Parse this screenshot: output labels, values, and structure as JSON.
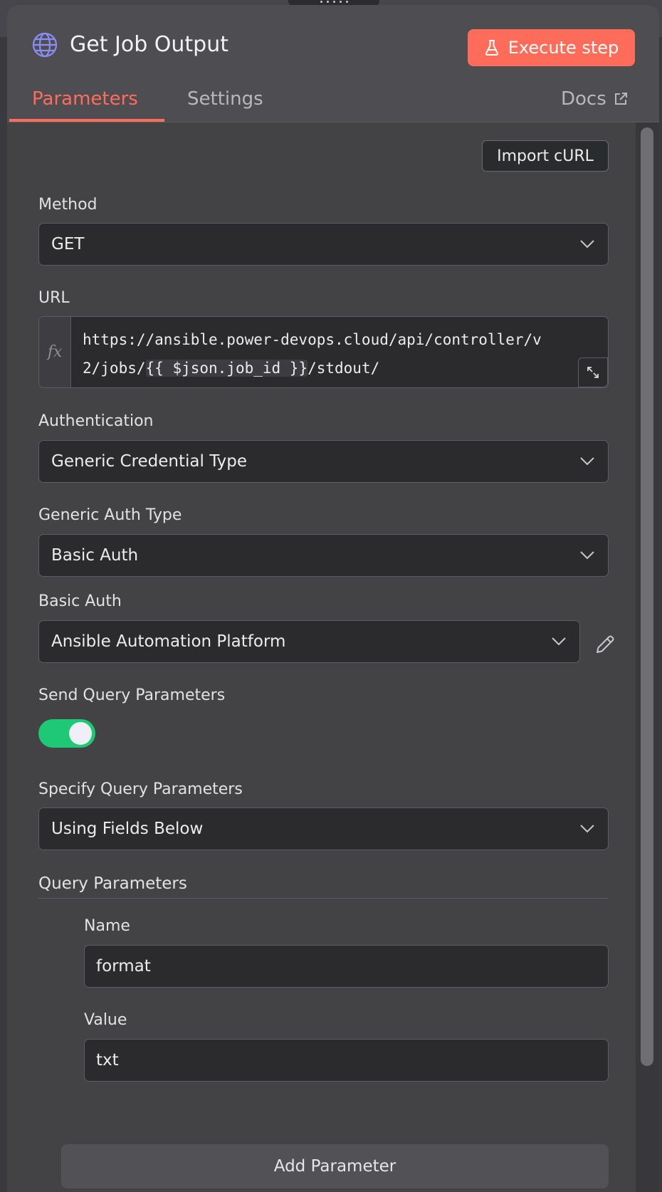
{
  "node": {
    "title": "Get Job Output",
    "execute_label": "Execute step"
  },
  "tabs": {
    "parameters": "Parameters",
    "settings": "Settings",
    "docs": "Docs"
  },
  "import_curl_label": "Import cURL",
  "method": {
    "label": "Method",
    "value": "GET"
  },
  "url": {
    "label": "URL",
    "fx": "fx",
    "line1": "https://ansible.power-devops.cloud/api/controller/v",
    "line2_prefix": "2/jobs/",
    "line2_expression": "{{ $json.job_id }}",
    "line2_suffix": "/stdout/"
  },
  "authentication": {
    "label": "Authentication",
    "value": "Generic Credential Type"
  },
  "generic_auth_type": {
    "label": "Generic Auth Type",
    "value": "Basic Auth"
  },
  "basic_auth": {
    "label": "Basic Auth",
    "value": "Ansible Automation Platform"
  },
  "send_query_parameters": {
    "label": "Send Query Parameters",
    "enabled": true
  },
  "specify_query_parameters": {
    "label": "Specify Query Parameters",
    "value": "Using Fields Below"
  },
  "query_parameters": {
    "title": "Query Parameters",
    "name_label": "Name",
    "name_value": "format",
    "value_label": "Value",
    "value_value": "txt",
    "add_label": "Add Parameter"
  },
  "colors": {
    "accent": "#ff6d5a",
    "toggle_on": "#1ec874",
    "globe": "#8c8cf5"
  },
  "icons": {
    "node": "globe-icon",
    "execute": "flask-icon",
    "docs": "external-link-icon",
    "select": "chevron-down-icon",
    "expand": "expand-icon",
    "edit": "pencil-icon"
  }
}
